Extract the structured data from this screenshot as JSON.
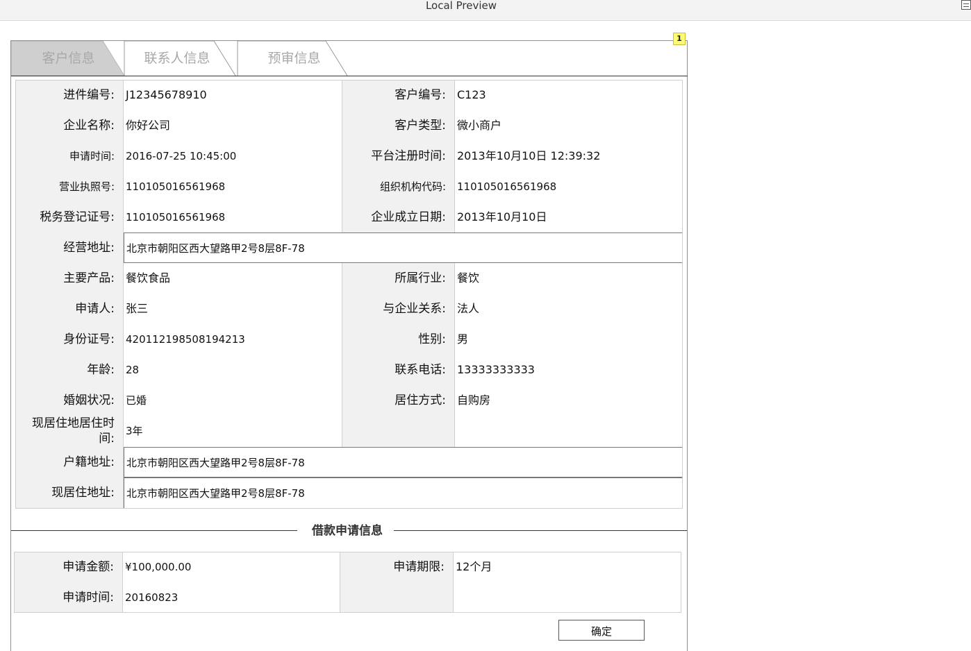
{
  "window": {
    "title": "Local Preview",
    "badge": "1"
  },
  "tabs": [
    {
      "label": "客户信息",
      "active": true
    },
    {
      "label": "联系人信息",
      "active": false
    },
    {
      "label": "预审信息",
      "active": false
    }
  ],
  "fields": {
    "case_no_label": "进件编号:",
    "case_no": "J12345678910",
    "customer_no_label": "客户编号:",
    "customer_no": "C123",
    "company_name_label": "企业名称:",
    "company_name": "你好公司",
    "customer_type_label": "客户类型:",
    "customer_type": "微小商户",
    "apply_time_label": "申请时间:",
    "apply_time": "2016-07-25 10:45:00",
    "register_time_label": "平台注册时间:",
    "register_time": "2013年10月10日 12:39:32",
    "license_no_label": "营业执照号:",
    "license_no": "110105016561968",
    "org_code_label": "组织机构代码:",
    "org_code": "110105016561968",
    "tax_no_label": "税务登记证号:",
    "tax_no": "110105016561968",
    "founded_label": "企业成立日期:",
    "founded": "2013年10月10日",
    "biz_address_label": "经营地址:",
    "biz_address": "北京市朝阳区西大望路甲2号8层8F-78",
    "main_product_label": "主要产品:",
    "main_product": "餐饮食品",
    "industry_label": "所属行业:",
    "industry": "餐饮",
    "applicant_label": "申请人:",
    "applicant": "张三",
    "relation_label": "与企业关系:",
    "relation": "法人",
    "id_no_label": "身份证号:",
    "id_no": "420112198508194213",
    "gender_label": "性别:",
    "gender": "男",
    "age_label": "年龄:",
    "age": "28",
    "phone_label": "联系电话:",
    "phone": "13333333333",
    "marital_label": "婚姻状况:",
    "marital": "已婚",
    "housing_label": "居住方式:",
    "housing": "自购房",
    "residence_time_label_1": "现居住地居住时",
    "residence_time_label_2": "间:",
    "residence_time": "3年",
    "household_address_label": "户籍地址:",
    "household_address": "北京市朝阳区西大望路甲2号8层8F-78",
    "current_address_label": "现居住地址:",
    "current_address": "北京市朝阳区西大望路甲2号8层8F-78"
  },
  "loan": {
    "section_title": "借款申请信息",
    "amount_label": "申请金额:",
    "amount": "¥100,000.00",
    "term_label": "申请期限:",
    "term": "12个月",
    "time_label": "申请时间:",
    "time": "20160823"
  },
  "actions": {
    "confirm_label": "确定"
  }
}
